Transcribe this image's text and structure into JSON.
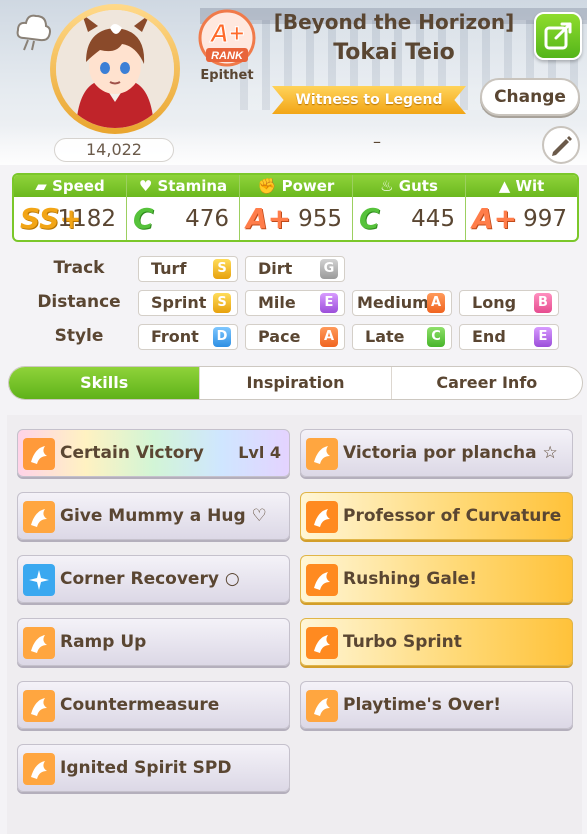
{
  "header": {
    "title": "[Beyond the Horizon]",
    "name": "Tokai Teio",
    "fans": "14,022",
    "rank_label": "RANK",
    "rank_grade": "A+",
    "epithet_label": "Epithet",
    "epithet": "Witness to Legend",
    "change_button": "Change",
    "dash": "–"
  },
  "stats": [
    {
      "label": "Speed",
      "grade": "SS+",
      "value": "1182",
      "icon": "shoe-icon",
      "grade_color": "#f2a516"
    },
    {
      "label": "Stamina",
      "grade": "C",
      "value": "476",
      "icon": "heart-icon",
      "grade_color": "#56c23b"
    },
    {
      "label": "Power",
      "grade": "A+",
      "value": "955",
      "icon": "muscle-icon",
      "grade_color": "#ff7d4a"
    },
    {
      "label": "Guts",
      "grade": "C",
      "value": "445",
      "icon": "flame-icon",
      "grade_color": "#56c23b"
    },
    {
      "label": "Wit",
      "grade": "A+",
      "value": "997",
      "icon": "grad-cap-icon",
      "grade_color": "#ff7d4a"
    }
  ],
  "aptitudes": {
    "track_label": "Track",
    "distance_label": "Distance",
    "style_label": "Style",
    "track": [
      {
        "name": "Turf",
        "grade": "S"
      },
      {
        "name": "Dirt",
        "grade": "G"
      }
    ],
    "distance": [
      {
        "name": "Sprint",
        "grade": "S"
      },
      {
        "name": "Mile",
        "grade": "E"
      },
      {
        "name": "Medium",
        "grade": "A"
      },
      {
        "name": "Long",
        "grade": "B"
      }
    ],
    "style": [
      {
        "name": "Front",
        "grade": "D"
      },
      {
        "name": "Pace",
        "grade": "A"
      },
      {
        "name": "Late",
        "grade": "C"
      },
      {
        "name": "End",
        "grade": "E"
      }
    ]
  },
  "tabs": [
    {
      "label": "Skills",
      "active": true
    },
    {
      "label": "Inspiration",
      "active": false
    },
    {
      "label": "Career Info",
      "active": false
    }
  ],
  "skills": [
    {
      "name": "Certain Victory",
      "level": "Lvl  4",
      "style": "rainbow",
      "icon": "unique-skill-icon"
    },
    {
      "name": "Victoria por plancha ☆",
      "level": "",
      "style": "normal",
      "icon": "speed-skill-icon"
    },
    {
      "name": "Give Mummy a Hug ♡",
      "level": "",
      "style": "normal",
      "icon": "speed-skill-icon"
    },
    {
      "name": "Professor of Curvature",
      "level": "",
      "style": "gold",
      "icon": "speed-skill-icon"
    },
    {
      "name": "Corner Recovery ○",
      "level": "",
      "style": "normal",
      "icon": "recovery-skill-icon"
    },
    {
      "name": "Rushing Gale!",
      "level": "",
      "style": "gold",
      "icon": "speed-skill-icon"
    },
    {
      "name": "Ramp Up",
      "level": "",
      "style": "normal",
      "icon": "speed-skill-icon"
    },
    {
      "name": "Turbo Sprint",
      "level": "",
      "style": "gold",
      "icon": "speed-skill-icon"
    },
    {
      "name": "Countermeasure",
      "level": "",
      "style": "normal",
      "icon": "speed-skill-icon"
    },
    {
      "name": "Playtime's Over!",
      "level": "",
      "style": "normal",
      "icon": "speed-skill-icon"
    },
    {
      "name": "Ignited Spirit SPD",
      "level": "",
      "style": "normal",
      "icon": "speed-skill-icon"
    }
  ]
}
